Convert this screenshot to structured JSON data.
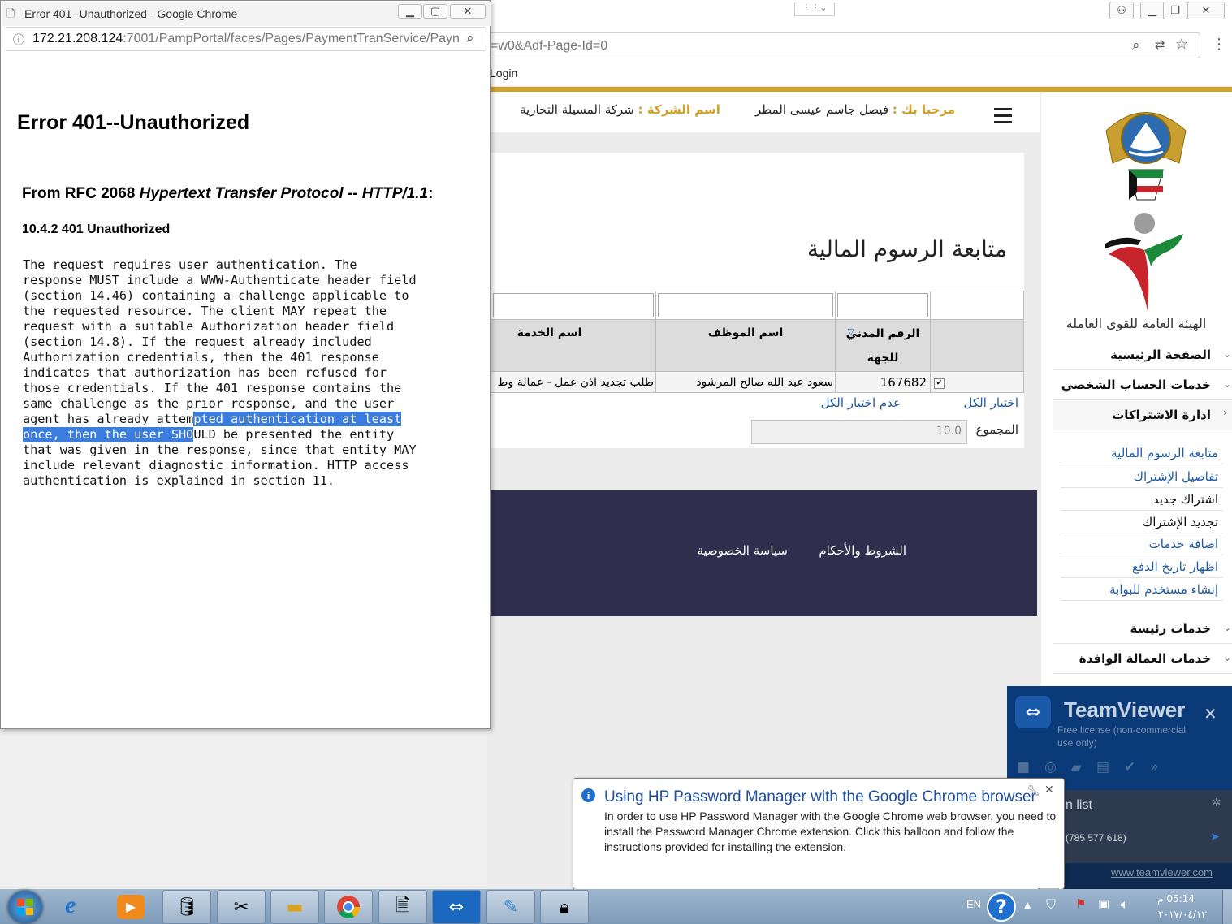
{
  "error_window": {
    "title": "Error 401--Unauthorized - Google Chrome",
    "url_host": "172.21.208.124",
    "url_rest": ":7001/PampPortal/faces/Pages/PaymentTranService/Payn",
    "heading": "Error 401--Unauthorized",
    "rfc_prefix": "From RFC 2068 ",
    "rfc_italic": "Hypertext Transfer Protocol -- HTTP/1.1",
    "rfc_suffix": ":",
    "section": "10.4.2 401 Unauthorized",
    "body_before_selection": "The request requires user authentication. The\nresponse MUST include a WWW-Authenticate header field\n(section 14.46) containing a challenge applicable to\nthe requested resource. The client MAY repeat the\nrequest with a suitable Authorization header field\n(section 14.8). If the request already included\nAuthorization credentials, then the 401 response\nindicates that authorization has been refused for\nthose credentials. If the 401 response contains the\nsame challenge as the prior response, and the user\nagent has already attem",
    "body_selected": "pted authentication at least\nonce, then the user SHO",
    "body_after_selection": "ULD be presented the entity\nthat was given in the response, since that entity MAY\ninclude relevant diagnostic information. HTTP access\nauthentication is explained in section 11."
  },
  "main_browser": {
    "url_tail": "=w0&Adf-Page-Id=0",
    "bookmark_login": "Login"
  },
  "portal": {
    "welcome_label": "مرحبا بك :",
    "welcome_name": "فيصل جاسم عيسى المطر",
    "company_label": "اسم الشركة :",
    "company_name": "شركة المسيلة التجارية",
    "page_title": "متابعة الرسوم المالية",
    "columns": [
      "الرقم المدني للجهة",
      "اسم الموظف",
      "اسم الخدمة"
    ],
    "row": {
      "civil_id": "167682",
      "employee": "سعود عبد الله صالح المرشود",
      "service": "طلب تجديد اذن عمل - عمالة وط"
    },
    "select_all": "اختيار الكل",
    "deselect_all": "عدم اختيار الكل",
    "total_label": "المجموع",
    "total_value": "10.0",
    "footer_links": [
      "الشروط والأحكام",
      "سياسة الخصوصية"
    ],
    "org_name": "الهيئة العامة للقوى العاملة",
    "menu_sections": [
      "الصفحة الرئيسية",
      "خدمات الحساب الشخصي",
      "ادارة الاشتراكات"
    ],
    "menu_links": [
      {
        "label": "متابعة الرسوم المالية",
        "color": "#1f5aa8"
      },
      {
        "label": "تفاصيل الإشتراك",
        "color": "#1f5aa8"
      },
      {
        "label": "اشتراك جديد",
        "color": "#111111"
      },
      {
        "label": "تجديد الإشتراك",
        "color": "#111111"
      },
      {
        "label": "اضافة خدمات",
        "color": "#1f5aa8"
      },
      {
        "label": "اظهار تاريخ الدفع",
        "color": "#1f5aa8"
      },
      {
        "label": "إنشاء مستخدم للبوابة",
        "color": "#1f5aa8"
      }
    ],
    "menu_sections_lower": [
      "خدمات رئيسة",
      "خدمات العمالة الوافدة"
    ]
  },
  "teamviewer": {
    "title": "TeamViewer",
    "license": "Free license (non-commercial use only)",
    "list_label": "n list",
    "partner_id": "(785 577 618)",
    "link": "www.teamviewer.com"
  },
  "balloon": {
    "title": "Using HP Password Manager with the Google Chrome browser",
    "body": "In order to use HP Password Manager with the Google Chrome web browser, you need to install the Password Manager Chrome extension. Click this balloon and follow the instructions provided for installing the extension."
  },
  "taskbar": {
    "lang": "EN",
    "time": "05:14 م",
    "date": "٢٠١٧/٠٤/١٣"
  },
  "colors": {
    "accent_gold": "#d4a128",
    "footer_navy": "#2f2e4d",
    "link_blue": "#1f5aa8"
  }
}
